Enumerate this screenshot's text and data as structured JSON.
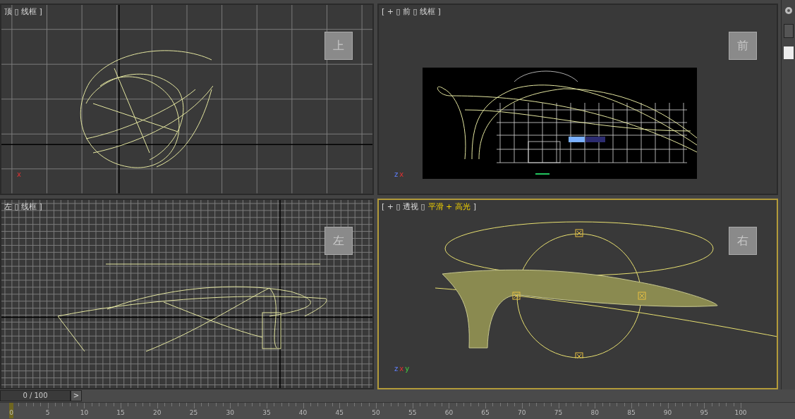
{
  "viewports": [
    {
      "kind": "top",
      "active": false,
      "label": [
        {
          "text": "顶 ▯ 线框 ]",
          "highlight": false
        }
      ],
      "cube_label": "上",
      "axes": [
        "x"
      ]
    },
    {
      "kind": "front",
      "active": false,
      "label": [
        {
          "text": "[ + ▯ 前 ▯ 线框 ]",
          "highlight": false
        }
      ],
      "cube_label": "前",
      "axes": [
        "z",
        "x"
      ]
    },
    {
      "kind": "left",
      "active": false,
      "label": [
        {
          "text": "左 ▯ 线框 ]",
          "highlight": false
        }
      ],
      "cube_label": "左"
    },
    {
      "kind": "perspective",
      "active": true,
      "label": [
        {
          "text": "[ + ▯ 透视 ▯",
          "highlight": false
        },
        {
          "text": "平滑 + 高光",
          "highlight": true
        },
        {
          "text": "]",
          "highlight": false
        }
      ],
      "cube_label": "右",
      "axes": [
        "z",
        "x",
        "y"
      ]
    }
  ],
  "timeline": {
    "frame_counter": "0 / 100",
    "next_button": ">",
    "level": 0,
    "ticks": [
      "0",
      "5",
      "10",
      "15",
      "20",
      "25",
      "30",
      "35",
      "40",
      "45",
      "50",
      "55",
      "60",
      "65",
      "70",
      "75",
      "80",
      "85",
      "90",
      "95",
      "100"
    ]
  }
}
